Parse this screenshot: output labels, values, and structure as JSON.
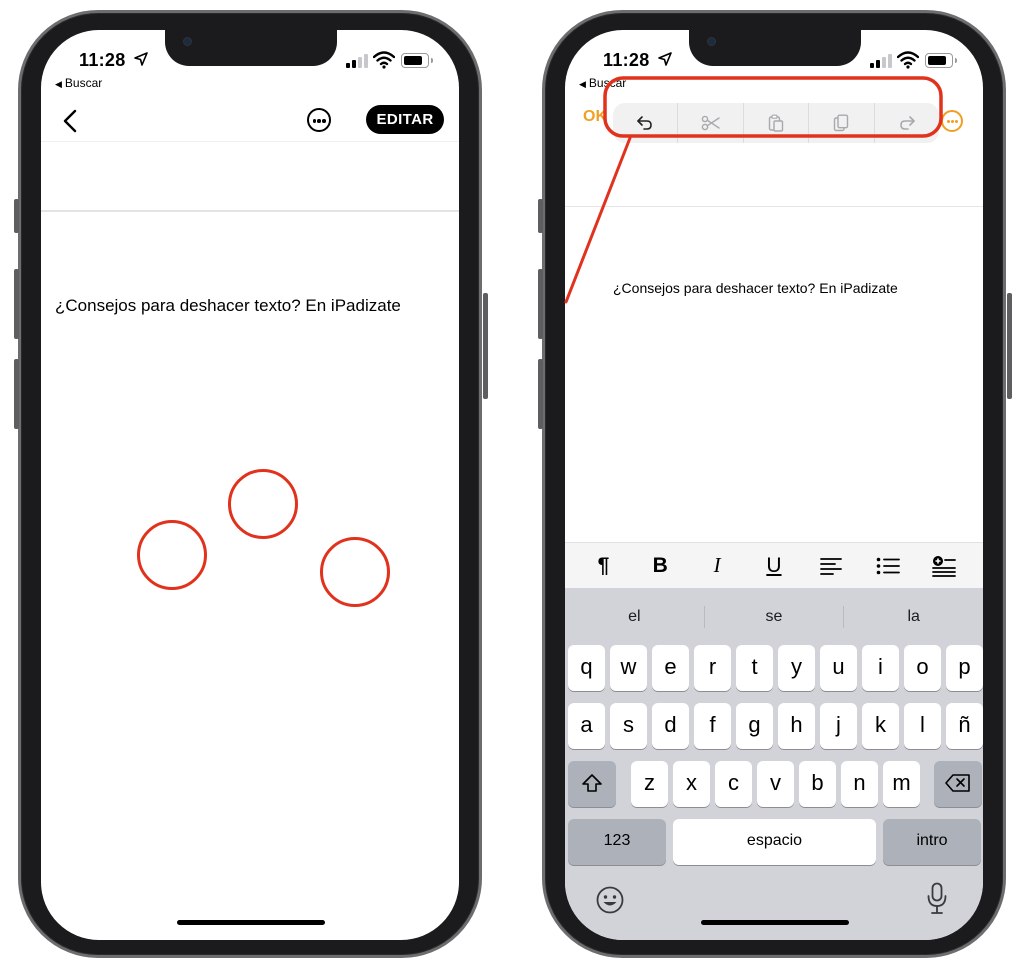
{
  "status_bar": {
    "time": "11:28",
    "back_app": "Buscar"
  },
  "left_phone": {
    "edit_button": "EDITAR",
    "note_text": "¿Consejos para deshacer texto? En iPadizate",
    "annotation_circles": 3
  },
  "right_phone": {
    "done_button": "OK",
    "note_text": "¿Consejos para deshacer texto? En iPadizate",
    "edit_toolbar": [
      "undo-icon",
      "cut-icon",
      "paste-icon",
      "copy-icon",
      "redo-icon"
    ],
    "format_bar": {
      "paragraph": "¶",
      "bold": "B",
      "italic": "I",
      "underline": "U",
      "icons": [
        "align-left-icon",
        "bullet-list-icon",
        "add-table-icon"
      ]
    },
    "keyboard": {
      "suggestions": [
        "el",
        "se",
        "la"
      ],
      "row1": [
        "q",
        "w",
        "e",
        "r",
        "t",
        "y",
        "u",
        "i",
        "o",
        "p"
      ],
      "row2": [
        "a",
        "s",
        "d",
        "f",
        "g",
        "h",
        "j",
        "k",
        "l",
        "ñ"
      ],
      "row3": [
        "z",
        "x",
        "c",
        "v",
        "b",
        "n",
        "m"
      ],
      "numbers_key": "123",
      "space_key": "espacio",
      "return_key": "intro"
    }
  },
  "colors": {
    "annotation_red": "#e0321c",
    "accent_orange": "#f0a024",
    "keyboard_bg": "#d1d3d9"
  }
}
